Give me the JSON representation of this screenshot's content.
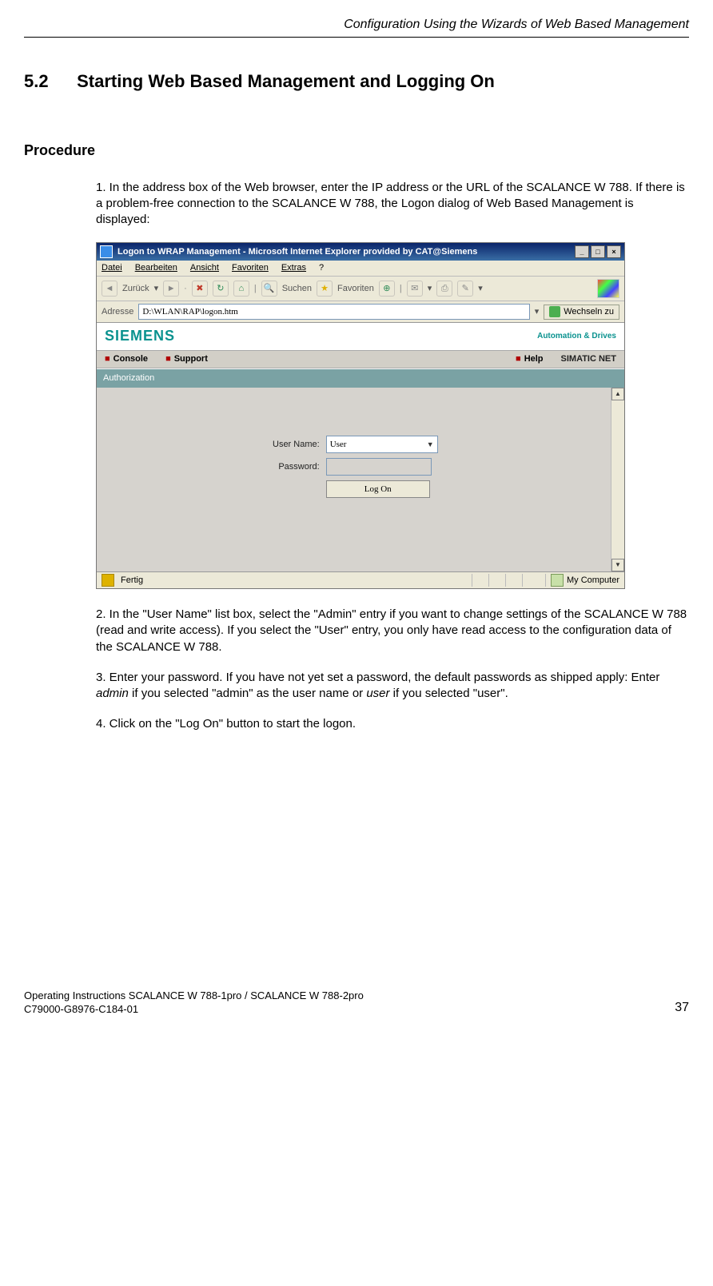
{
  "running_head": "Configuration Using the Wizards of Web Based Management",
  "section": {
    "number": "5.2",
    "title": "Starting Web Based Management and Logging On"
  },
  "subhead": "Procedure",
  "steps": {
    "s1": "1.  In the address box of the Web browser, enter the IP address or the URL of the SCALANCE W 788. If there is a problem-free connection to the SCALANCE W 788, the Logon dialog of Web Based Management is displayed:",
    "s2": "2.  In the \"User Name\" list box, select the \"Admin\" entry if you want to change settings of the SCALANCE W 788 (read and write access). If you select the \"User\" entry, you only have read access to the configuration data of the SCALANCE W 788.",
    "s3_a": "3.  Enter your password. If you have not yet set a password, the default passwords as shipped apply: Enter ",
    "s3_admin": "admin",
    "s3_b": " if you selected \"admin\" as the user name or ",
    "s3_user": "user",
    "s3_c": " if you selected \"user\".",
    "s4": "4.  Click on the \"Log On\" button to start the logon."
  },
  "shot": {
    "title": "Logon to WRAP Management - Microsoft Internet Explorer provided by CAT@Siemens",
    "menu": {
      "datei": "Datei",
      "bearb": "Bearbeiten",
      "ansicht": "Ansicht",
      "fav": "Favoriten",
      "extras": "Extras",
      "help": "?"
    },
    "toolbar": {
      "back": "Zurück",
      "search": "Suchen",
      "favorites": "Favoriten"
    },
    "addr": {
      "label": "Adresse",
      "value": "D:\\WLAN\\RAP\\logon.htm",
      "go": "Wechseln zu"
    },
    "brand": {
      "siemens": "SIEMENS",
      "autod": "Automation & Drives"
    },
    "nav": {
      "console": "Console",
      "support": "Support",
      "help": "Help",
      "net": "SIMATIC NET"
    },
    "auth": "Authorization",
    "form": {
      "userlabel": "User Name:",
      "uservalue": "User",
      "pwlabel": "Password:",
      "logon": "Log On"
    },
    "status": {
      "done": "Fertig",
      "computer": "My Computer"
    }
  },
  "footer": {
    "l1": "Operating Instructions SCALANCE W 788-1pro / SCALANCE W 788-2pro",
    "l2": "C79000-G8976-C184-01",
    "page": "37"
  }
}
